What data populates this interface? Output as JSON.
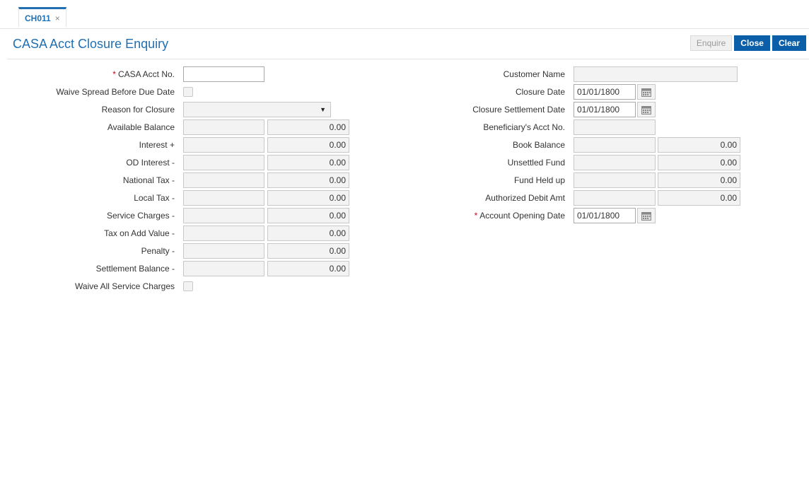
{
  "tab": {
    "label": "CH011",
    "close_glyph": "×"
  },
  "header": {
    "title": "CASA Acct Closure Enquiry"
  },
  "buttons": {
    "enquire": "Enquire",
    "close": "Close",
    "clear": "Clear"
  },
  "left": {
    "casa_acct_no": {
      "label": "CASA Acct No.",
      "required_mark": "*",
      "value": ""
    },
    "waive_spread": {
      "label": "Waive Spread Before Due Date",
      "checked": false
    },
    "reason_for_closure": {
      "label": "Reason for Closure",
      "value": ""
    },
    "available_balance": {
      "label": "Available Balance",
      "ccy": "",
      "amount": "0.00"
    },
    "interest": {
      "label": "Interest +",
      "ccy": "",
      "amount": "0.00"
    },
    "od_interest": {
      "label": "OD Interest -",
      "ccy": "",
      "amount": "0.00"
    },
    "national_tax": {
      "label": "National Tax -",
      "ccy": "",
      "amount": "0.00"
    },
    "local_tax": {
      "label": "Local Tax -",
      "ccy": "",
      "amount": "0.00"
    },
    "service_charges": {
      "label": "Service Charges -",
      "ccy": "",
      "amount": "0.00"
    },
    "tax_on_add_value": {
      "label": "Tax on Add Value -",
      "ccy": "",
      "amount": "0.00"
    },
    "penalty": {
      "label": "Penalty -",
      "ccy": "",
      "amount": "0.00"
    },
    "settlement_balance": {
      "label": "Settlement Balance -",
      "ccy": "",
      "amount": "0.00"
    },
    "waive_all_service_charges": {
      "label": "Waive All Service Charges",
      "checked": false
    }
  },
  "right": {
    "customer_name": {
      "label": "Customer Name",
      "value": ""
    },
    "closure_date": {
      "label": "Closure Date",
      "value": "01/01/1800"
    },
    "closure_settlement_date": {
      "label": "Closure Settlement Date",
      "value": "01/01/1800"
    },
    "beneficiary_acct_no": {
      "label": "Beneficiary's Acct No.",
      "value": ""
    },
    "book_balance": {
      "label": "Book Balance",
      "ccy": "",
      "amount": "0.00"
    },
    "unsettled_fund": {
      "label": "Unsettled Fund",
      "ccy": "",
      "amount": "0.00"
    },
    "fund_held_up": {
      "label": "Fund Held up",
      "ccy": "",
      "amount": "0.00"
    },
    "authorized_debit_amt": {
      "label": "Authorized Debit Amt",
      "ccy": "",
      "amount": "0.00"
    },
    "account_opening_date": {
      "label": "Account Opening Date",
      "required_mark": "*",
      "value": "01/01/1800"
    }
  },
  "icons": {
    "calendar": "calendar-icon",
    "dropdown": "chevron-down-icon",
    "close": "close-icon"
  },
  "colors": {
    "accent": "#1f6fb2",
    "button": "#0b5ea8",
    "required": "#d0021b"
  }
}
